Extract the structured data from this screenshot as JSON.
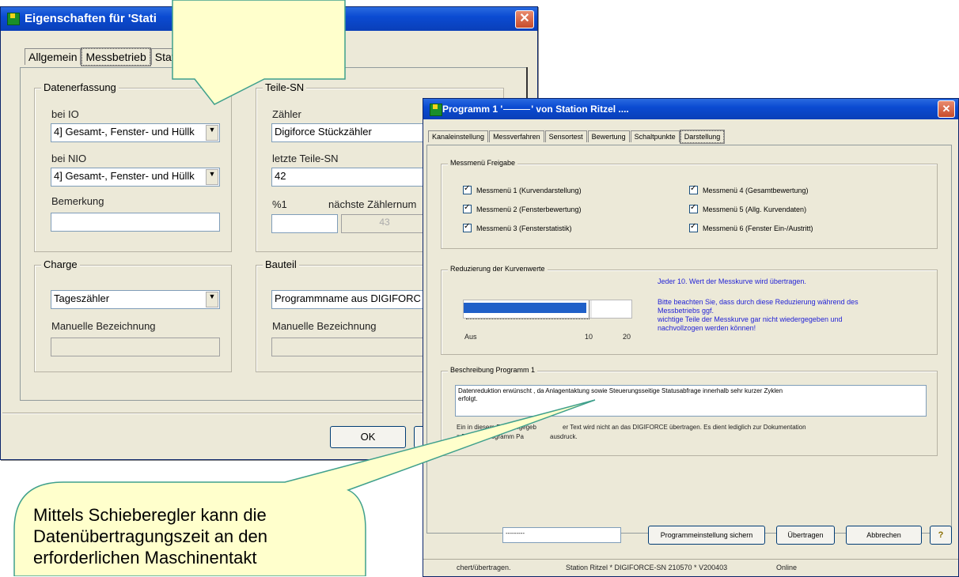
{
  "win1": {
    "title": "Eigenschaften für 'Stati",
    "close_glyph": "✕",
    "tabs": [
      "Allgemein",
      "Messbetrieb",
      "Statis"
    ],
    "datenerfassung": {
      "caption": "Datenerfassung",
      "bei_io_label": "bei IO",
      "bei_io_value": "4] Gesamt-, Fenster- und Hüllk",
      "bei_nio_label": "bei NIO",
      "bei_nio_value": "4] Gesamt-, Fenster- und Hüllk",
      "bemerkung_label": "Bemerkung",
      "bemerkung_value": ""
    },
    "teile_sn": {
      "caption": "Teile-SN",
      "zaehler_label": "Zähler",
      "zaehler_value": "Digiforce Stückzähler",
      "letzte_label": "letzte Teile-SN",
      "letzte_value": "42",
      "prefix_label": "%1",
      "naechste_label": "nächste Zählernum",
      "naechste_value": "43"
    },
    "charge": {
      "caption": "Charge",
      "select_value": "Tageszähler",
      "manual_label": "Manuelle Bezeichnung"
    },
    "bauteil": {
      "caption": "Bauteil",
      "select_value": "Programmname aus DIGIFORC",
      "manual_label": "Manuelle Bezeichnung"
    },
    "ok_label": "OK"
  },
  "win2": {
    "title": "Programm 1 '",
    "title_rest": "' von Station Ritzel ....",
    "close_glyph": "✕",
    "tabs": [
      "Kanaleinstellung",
      "Messverfahren",
      "Sensortest",
      "Bewertung",
      "Schaltpunkte",
      "Darstellung"
    ],
    "freigabe": {
      "caption": "Messmenü Freigabe",
      "items": [
        "Messmenü 1 (Kurvendarstellung)",
        "Messmenü 2 (Fensterbewertung)",
        "Messmenü 3 (Fensterstatistik)",
        "Messmenü 4 (Gesamtbewertung)",
        "Messmenü 5 (Allg. Kurvendaten)",
        "Messmenü 6 (Fenster Ein-/Austritt)"
      ]
    },
    "reduzierung": {
      "caption": "Reduzierung der Kurvenwerte",
      "slider_fraction": 0.5,
      "label_aus": "Aus",
      "label_10": "10",
      "label_20": "20",
      "info_line1": "Jeder 10. Wert der Messkurve wird übertragen.",
      "info_line2": "Bitte beachten Sie, dass durch diese Reduzierung während des",
      "info_line3": "Messbetriebs ggf.",
      "info_line4": "wichtige Teile der Messkurve gar nicht wiedergegeben und",
      "info_line5": "nachvollzogen werden können!"
    },
    "beschreibung": {
      "caption": "Beschreibung Programm 1",
      "text_line1": "Datenreduktion erwünscht , da Anlagentaktung sowie Steuerungsseitige Statusabfrage innerhalb sehr kurzer Zyklen",
      "text_line2": "erfolgt.",
      "note_line1": "Ein in diesem Feld eingegeb",
      "note_line1b": "er Text wird nicht an das DIGIFORCE übertragen. Es dient lediglich zur Dokumentation",
      "note_line2": "z.B. beim Programm Pa",
      "note_line2b": "ausdruck."
    },
    "bottom": {
      "name_value": "---------",
      "save_label": "Programmeinstellung sichern",
      "transfer_label": "Übertragen",
      "cancel_label": "Abbrechen",
      "help_glyph": "?"
    },
    "status": {
      "part1": "chert/übertragen.",
      "part2": "Station Ritzel * DIGIFORCE-SN 210570 * V200403",
      "part3": "Online"
    }
  },
  "callout_bottom": {
    "line1": "Mittels Schieberegler kann die",
    "line2": "Datenübertragungszeit an den",
    "line3": "erforderlichen Maschinentakt"
  },
  "colors": {
    "titlebar": "#0b4bd2",
    "callout_fill": "#ffffcc",
    "callout_border": "#3fa08c",
    "info_text": "#1f1fd6",
    "slider_fill": "#2060c8"
  }
}
